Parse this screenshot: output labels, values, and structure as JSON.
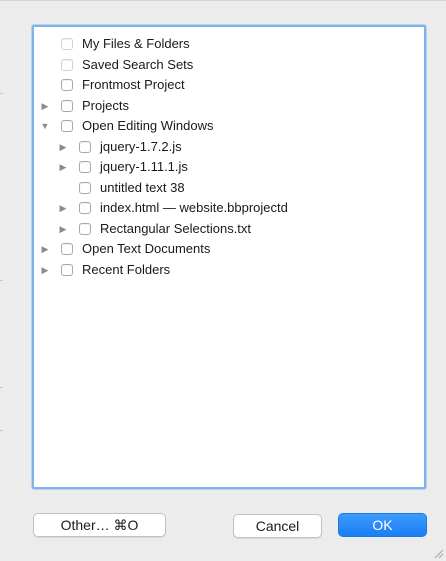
{
  "colors": {
    "accent": "#1a7ef5",
    "focus_ring": "#7fb1ec",
    "background": "#ececec"
  },
  "tree": {
    "items": [
      {
        "label": "My Files & Folders",
        "depth": 0,
        "disclosure": "none",
        "dim": true
      },
      {
        "label": "Saved Search Sets",
        "depth": 0,
        "disclosure": "none",
        "dim": true
      },
      {
        "label": "Frontmost Project",
        "depth": 0,
        "disclosure": "none",
        "dim": false
      },
      {
        "label": "Projects",
        "depth": 0,
        "disclosure": "collapsed",
        "dim": false
      },
      {
        "label": "Open Editing Windows",
        "depth": 0,
        "disclosure": "expanded",
        "dim": false
      },
      {
        "label": "jquery-1.7.2.js",
        "depth": 1,
        "disclosure": "collapsed",
        "dim": false
      },
      {
        "label": "jquery-1.11.1.js",
        "depth": 1,
        "disclosure": "collapsed",
        "dim": false
      },
      {
        "label": "untitled text 38",
        "depth": 1,
        "disclosure": "none",
        "dim": false
      },
      {
        "label": "index.html — website.bbprojectd",
        "depth": 1,
        "disclosure": "collapsed",
        "dim": false
      },
      {
        "label": "Rectangular Selections.txt",
        "depth": 1,
        "disclosure": "collapsed",
        "dim": false
      },
      {
        "label": "Open Text Documents",
        "depth": 0,
        "disclosure": "collapsed",
        "dim": false
      },
      {
        "label": "Recent Folders",
        "depth": 0,
        "disclosure": "collapsed",
        "dim": false
      }
    ]
  },
  "buttons": {
    "other_label": "Other… ⌘O",
    "cancel_label": "Cancel",
    "ok_label": "OK"
  }
}
